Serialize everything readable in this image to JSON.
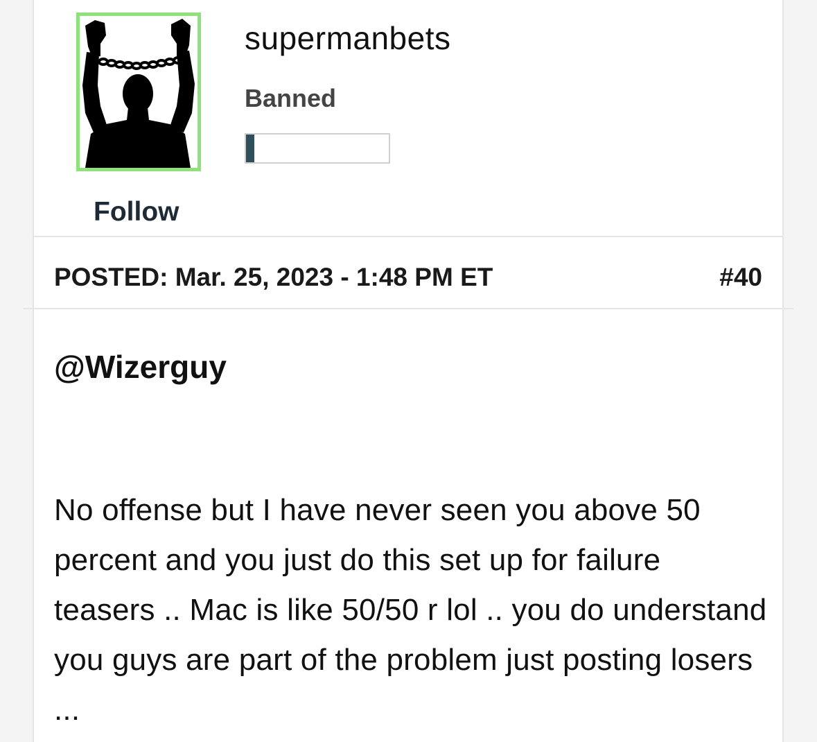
{
  "user": {
    "username": "supermanbets",
    "rank": "Banned",
    "reputation_fraction": 0.06,
    "avatar_icon": "chained-man-silhouette-icon",
    "avatar_border_color": "#8fe27a",
    "follow_label": "Follow"
  },
  "post": {
    "posted_label": "POSTED: Mar. 25, 2023 - 1:48 PM ET",
    "number": "#40",
    "mention": "@Wizerguy",
    "body": " No offense but I have never seen you above 50 percent and you just do this set up for failure teasers .. Mac is like 50/50 r lol .. you do understand you guys are part of the problem just posting losers ..."
  }
}
